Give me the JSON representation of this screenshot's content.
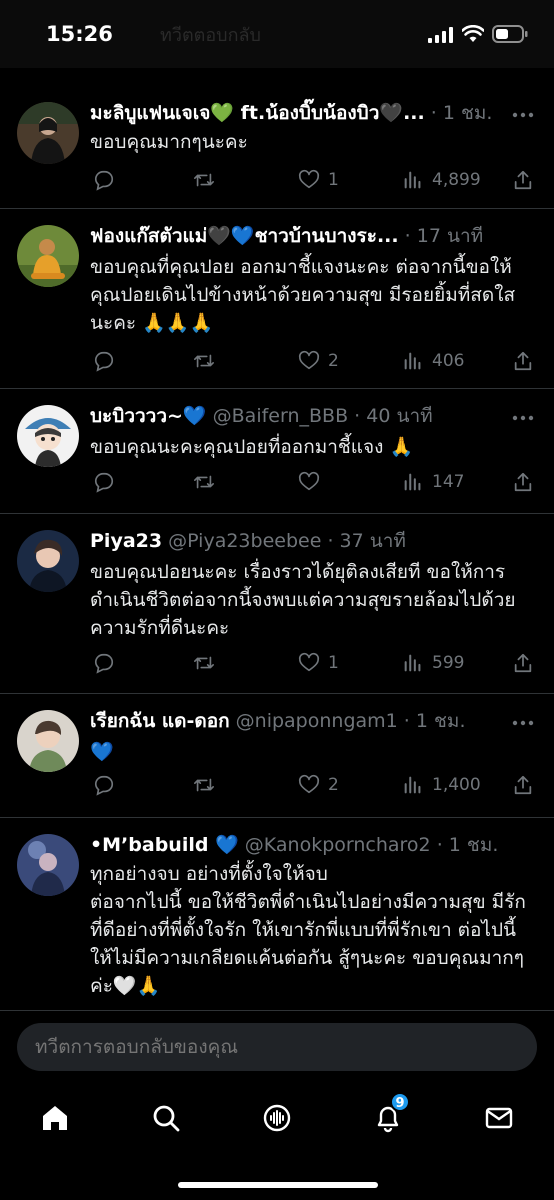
{
  "status": {
    "time": "15:26",
    "header_ghost": "ทวีตตอบกลับ"
  },
  "colors": {
    "accent": "#1d9bf0",
    "background": "#000000",
    "muted": "#71767b",
    "divider": "#2f3336"
  },
  "replies": [
    {
      "name": "มะลิบูแฟนเจเจ💚 ft.น้องบิ๊บน้องบิว🖤...",
      "handle": "",
      "time": "1 ชม.",
      "text": "ขอบคุณมากๆนะคะ",
      "reply_count": "",
      "retweet_count": "",
      "like_count": "1",
      "view_count": "4,899"
    },
    {
      "name": "ฟองแก๊สตัวแม่🖤💙ชาวบ้านบางระ...",
      "handle": "",
      "time": "17 นาที",
      "text": "ขอบคุณที่คุณปอย ออกมาชี้แจงนะคะ ต่อจากนี้ขอให้คุณปอยเดินไปข้างหน้าด้วยความสุข มีรอยยิ้มที่สดใสนะคะ 🙏🙏🙏",
      "reply_count": "",
      "retweet_count": "",
      "like_count": "2",
      "view_count": "406"
    },
    {
      "name": "บะบิวววว~💙",
      "handle": "@Baifern_BBB",
      "time": "40 นาที",
      "text": "ขอบคุณนะคะคุณปอยที่ออกมาชี้แจง 🙏",
      "reply_count": "",
      "retweet_count": "",
      "like_count": "",
      "view_count": "147"
    },
    {
      "name": "Piya23",
      "handle": "@Piya23beebee",
      "time": "37 นาที",
      "text": "ขอบคุณปอยนะคะ เรื่องราวได้ยุติลงเสียที ขอให้การดำเนินชีวิตต่อจากนี้จงพบแต่ความสุขรายล้อมไปด้วยความรักที่ดีนะคะ",
      "reply_count": "",
      "retweet_count": "",
      "like_count": "1",
      "view_count": "599"
    },
    {
      "name": "เรียกฉัน แด-ดอก",
      "handle": "@nipaponngam1",
      "time": "1 ชม.",
      "text": "💙",
      "reply_count": "",
      "retweet_count": "",
      "like_count": "2",
      "view_count": "1,400"
    },
    {
      "name": "•M’babuild 💙",
      "handle": "@Kanokporncharo2",
      "time": "1 ชม.",
      "text": "ทุกอย่างจบ อย่างที่ตั้งใจให้จบ\nต่อจากไปนี้ ขอให้ชีวิตพี่ดำเนินไปอย่างมีความสุข มีรักที่ดีอย่างที่พี่ตั้งใจรัก ให้เขารักพี่แบบที่พี่รักเขา ต่อไปนี้ให้ไม่มีความเกลียดแค้นต่อกัน สู้ๆนะคะ ขอบคุณมากๆค่ะ🤍🙏",
      "reply_count": "",
      "retweet_count": "",
      "like_count": "",
      "view_count": ""
    }
  ],
  "compose": {
    "placeholder": "ทวีตการตอบกลับของคุณ"
  },
  "tabbar": {
    "items": [
      {
        "icon": "home-icon"
      },
      {
        "icon": "search-icon"
      },
      {
        "icon": "spaces-icon"
      },
      {
        "icon": "bell-icon",
        "badge": "9"
      },
      {
        "icon": "mail-icon"
      }
    ]
  }
}
